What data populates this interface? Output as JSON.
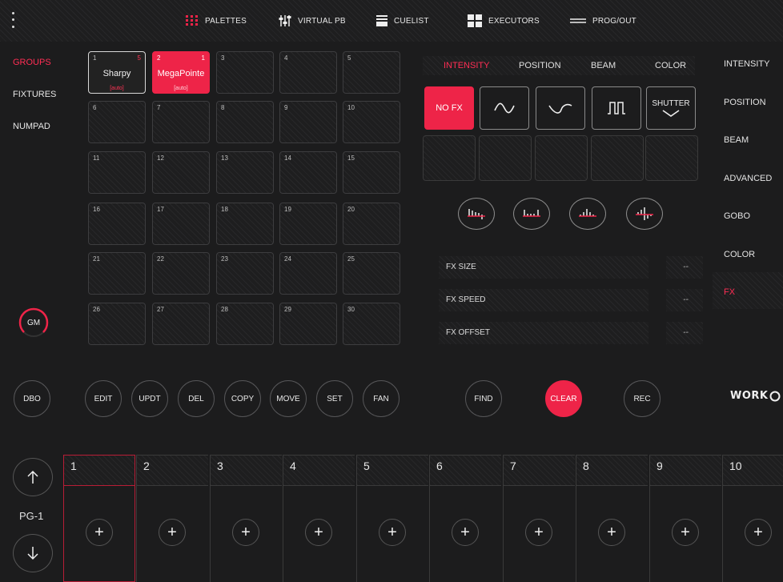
{
  "topbar": {
    "nav": [
      {
        "label": "PALETTES",
        "icon": "palette-grid-icon"
      },
      {
        "label": "VIRTUAL PB",
        "icon": "faders-icon"
      },
      {
        "label": "CUELIST",
        "icon": "cuelist-icon"
      },
      {
        "label": "EXECUTORS",
        "icon": "executors-icon"
      },
      {
        "label": "PROG/OUT",
        "icon": "prog-out-icon"
      }
    ]
  },
  "sidebar": {
    "items": [
      {
        "label": "GROUPS",
        "active": true
      },
      {
        "label": "FIXTURES",
        "active": false
      },
      {
        "label": "NUMPAD",
        "active": false
      }
    ],
    "gm_label": "GM"
  },
  "groups": {
    "cells": [
      {
        "num": "1",
        "count": "5",
        "name": "Sharpy",
        "sub": "[auto]",
        "state": "selected"
      },
      {
        "num": "2",
        "count": "1",
        "name": "MegaPointe",
        "sub": "[auto]",
        "state": "active"
      },
      {
        "num": "3"
      },
      {
        "num": "4"
      },
      {
        "num": "5"
      },
      {
        "num": "6"
      },
      {
        "num": "7"
      },
      {
        "num": "8"
      },
      {
        "num": "9"
      },
      {
        "num": "10"
      },
      {
        "num": "11"
      },
      {
        "num": "12"
      },
      {
        "num": "13"
      },
      {
        "num": "14"
      },
      {
        "num": "15"
      },
      {
        "num": "16"
      },
      {
        "num": "17"
      },
      {
        "num": "18"
      },
      {
        "num": "19"
      },
      {
        "num": "20"
      },
      {
        "num": "21"
      },
      {
        "num": "22"
      },
      {
        "num": "23"
      },
      {
        "num": "24"
      },
      {
        "num": "25"
      },
      {
        "num": "26"
      },
      {
        "num": "27"
      },
      {
        "num": "28"
      },
      {
        "num": "29"
      },
      {
        "num": "30"
      }
    ]
  },
  "fx": {
    "tabs": [
      {
        "label": "INTENSITY",
        "active": true
      },
      {
        "label": "POSITION",
        "active": false
      },
      {
        "label": "BEAM",
        "active": false
      },
      {
        "label": "COLOR",
        "active": false
      }
    ],
    "waves": [
      {
        "label": "NO FX",
        "icon": "",
        "active": true
      },
      {
        "label": "",
        "icon": "sine-wave-icon",
        "active": false
      },
      {
        "label": "",
        "icon": "cosine-wave-icon",
        "active": false
      },
      {
        "label": "",
        "icon": "square-wave-icon",
        "active": false
      },
      {
        "label": "SHUTTER",
        "icon": "shutter-wave-icon",
        "active": false
      }
    ],
    "distributions": [
      "spread-left-icon",
      "spread-right-icon",
      "spread-center-icon",
      "spread-split-icon"
    ],
    "params": [
      {
        "label": "FX SIZE",
        "value": "--"
      },
      {
        "label": "FX SPEED",
        "value": "--"
      },
      {
        "label": "FX OFFSET",
        "value": "--"
      }
    ]
  },
  "right_menu": {
    "items": [
      "INTENSITY",
      "POSITION",
      "BEAM",
      "ADVANCED",
      "GOBO",
      "COLOR"
    ],
    "selected": "FX"
  },
  "commands": {
    "dbo": "DBO",
    "buttons": [
      "EDIT",
      "UPDT",
      "DEL",
      "COPY",
      "MOVE",
      "SET",
      "FAN"
    ],
    "find": "FIND",
    "clear": "CLEAR",
    "rec": "REC"
  },
  "logo_text": "WORK",
  "executors": {
    "page_label": "PG-1",
    "items": [
      "1",
      "2",
      "3",
      "4",
      "5",
      "6",
      "7",
      "8",
      "9",
      "10"
    ],
    "plus_glyph": "+"
  },
  "colors": {
    "accent": "#ee2448",
    "background": "#1c1c1d",
    "text": "#e0e0e0"
  }
}
